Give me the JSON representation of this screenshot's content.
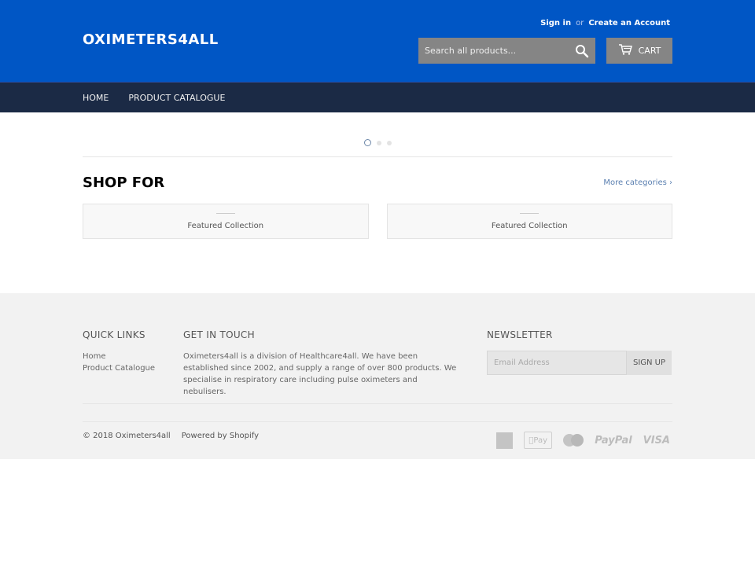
{
  "header": {
    "logo": "OXIMETERS4ALL",
    "sign_in": "Sign in",
    "or": "or",
    "create_account": "Create an Account",
    "search_placeholder": "Search all products...",
    "cart_label": "CART"
  },
  "nav": {
    "items": [
      {
        "label": "HOME"
      },
      {
        "label": "PRODUCT CATALOGUE"
      }
    ]
  },
  "slider": {
    "dots": 3,
    "active_index": 0
  },
  "shop": {
    "title": "SHOP FOR",
    "more_link": "More categories ›",
    "collections": [
      {
        "label": "Featured Collection"
      },
      {
        "label": "Featured Collection"
      }
    ]
  },
  "footer": {
    "quick_links": {
      "title": "QUICK LINKS",
      "items": [
        {
          "label": "Home"
        },
        {
          "label": "Product Catalogue"
        }
      ]
    },
    "get_in_touch": {
      "title": "GET IN TOUCH",
      "text": "Oximeters4all is a division of Healthcare4all. We have been established since 2002, and supply a range of over 800 products. We specialise in respiratory care including pulse oximeters and nebulisers."
    },
    "newsletter": {
      "title": "NEWSLETTER",
      "email_placeholder": "Email Address",
      "signup_label": "SIGN UP"
    },
    "copyright": "© 2018 Oximeters4all",
    "powered_by": "Powered by Shopify",
    "payments": {
      "amex": "american-express-icon",
      "apple_pay": "Pay",
      "master": "master-card-icon",
      "paypal": "PayPal",
      "visa": "VISA"
    }
  },
  "colors": {
    "header_bg": "#0056c5",
    "nav_bg": "#1b2a45",
    "footer_bg": "#f2f2f2",
    "link_accent": "#5a7fb0"
  }
}
